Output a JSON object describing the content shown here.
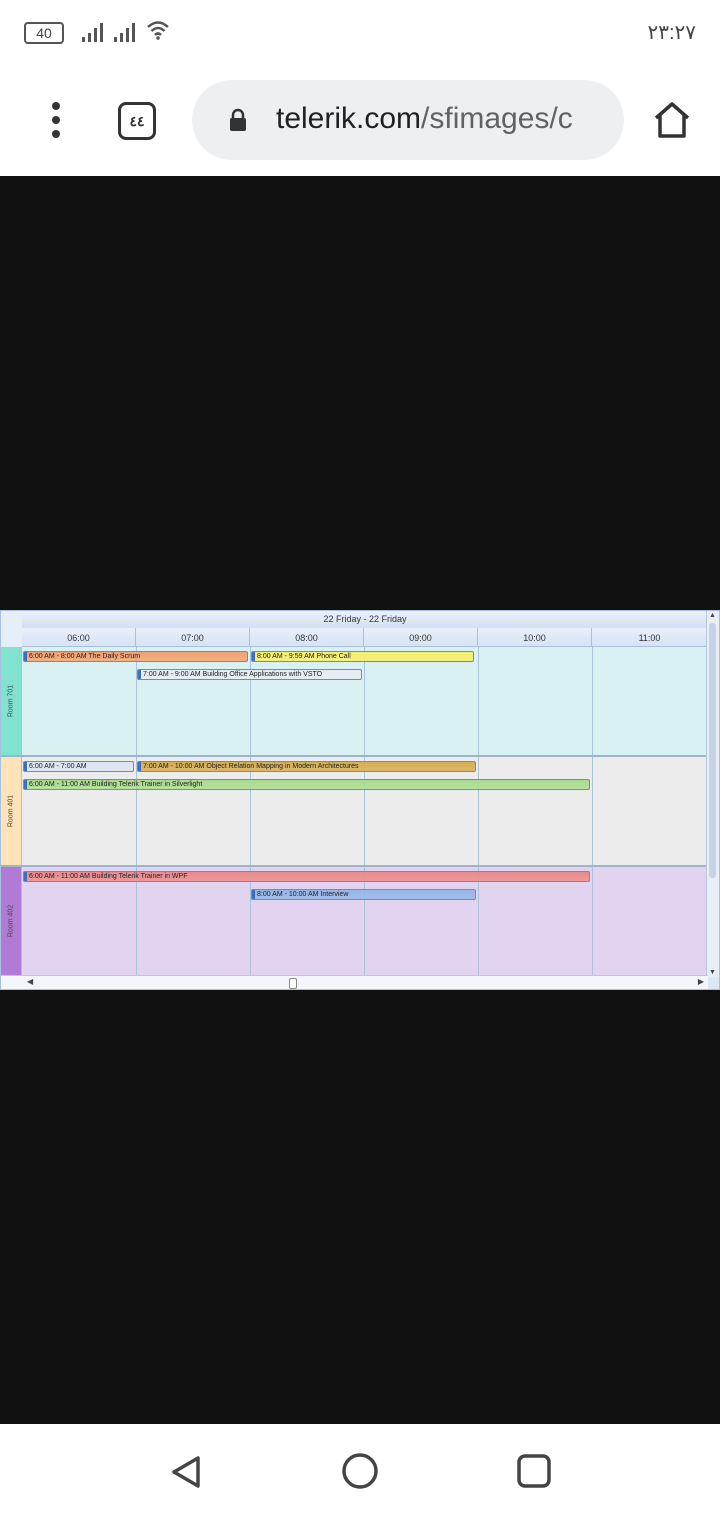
{
  "statusbar": {
    "battery": "40",
    "time": "۲۳:۲۷",
    "icons": [
      "battery-icon",
      "signal-icon",
      "signal-icon",
      "wifi-icon"
    ]
  },
  "browser": {
    "url_domain": "telerik.com",
    "url_path": "/sfimages/c",
    "tabs_label": "٤٤",
    "icons": [
      "menu-icon",
      "tabs-icon",
      "lock-icon",
      "home-icon"
    ]
  },
  "scheduler": {
    "date_header": "22 Friday - 22 Friday",
    "hours": [
      "06:00",
      "07:00",
      "08:00",
      "09:00",
      "10:00",
      "11:00"
    ],
    "rooms": [
      {
        "name": "Room 701",
        "label_color": "#7fe3cf",
        "bg_color": "#d9f1f3",
        "appointments": [
          {
            "text": "6:00 AM - 8:00 AM The Daily Scrum",
            "start": 6.0,
            "end": 8.0,
            "row": 0,
            "color": "#f4a06e"
          },
          {
            "text": "8:00 AM - 9:59 AM Phone Call",
            "start": 8.0,
            "end": 9.98,
            "row": 0,
            "color": "#f7ef6a"
          },
          {
            "text": "7:00 AM - 9:00 AM Building Office Applications with VSTO",
            "start": 7.0,
            "end": 9.0,
            "row": 1,
            "color": "#e8ecf3"
          }
        ]
      },
      {
        "name": "Room 401",
        "label_color": "#ffe3b8",
        "bg_color": "#ececec",
        "appointments": [
          {
            "text": "6:00 AM - 7:00 AM",
            "start": 6.0,
            "end": 7.0,
            "row": 0,
            "color": "#dce5f2"
          },
          {
            "text": "7:00 AM - 10:00 AM Object Relation Mapping in Modern Architectures",
            "start": 7.0,
            "end": 10.0,
            "row": 0,
            "color": "#d6ad4f"
          },
          {
            "text": "6:00 AM - 11:00 AM Building Telerik Trainer in Silverlight",
            "start": 6.0,
            "end": 11.0,
            "row": 1,
            "color": "#a8dc8d"
          }
        ]
      },
      {
        "name": "Room 402",
        "label_color": "#b07ad6",
        "bg_color": "#e2d3f0",
        "appointments": [
          {
            "text": "6:00 AM - 11:00 AM Building Telerik Trainer in WPF",
            "start": 6.0,
            "end": 11.0,
            "row": 0,
            "color": "#ec8a8a"
          },
          {
            "text": "8:00 AM - 10:00 AM Interview",
            "start": 8.0,
            "end": 10.0,
            "row": 1,
            "color": "#94b7e6"
          }
        ]
      }
    ]
  },
  "navbar": {
    "icons": [
      "back-icon",
      "home-circle-icon",
      "recents-icon"
    ]
  }
}
